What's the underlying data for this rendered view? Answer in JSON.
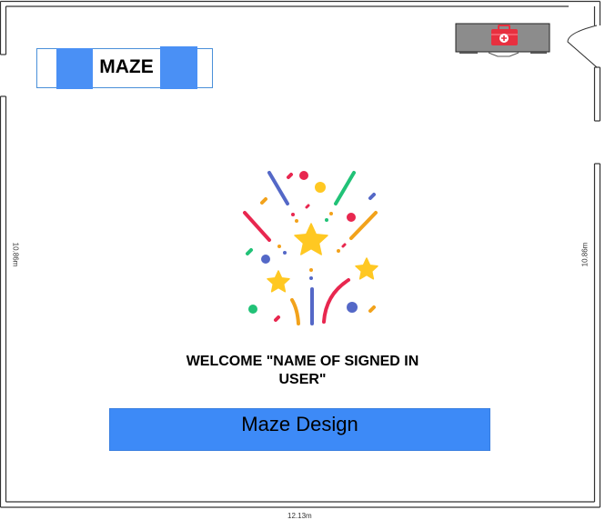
{
  "floor_plan": {
    "dimension_left": "10.86m",
    "dimension_right": "10.86m",
    "dimension_bottom": "12.13m"
  },
  "logo": {
    "text": "MAZE",
    "brand_color": "#4a90f5"
  },
  "cabinet": {
    "icon": "first-aid-kit-icon",
    "accent_color": "#e8303f"
  },
  "illustration": {
    "icon": "celebration-confetti-icon"
  },
  "welcome": {
    "text": "WELCOME \"NAME OF SIGNED IN USER\""
  },
  "primary_action": {
    "label": "Maze Design",
    "color": "#3d8af7"
  }
}
